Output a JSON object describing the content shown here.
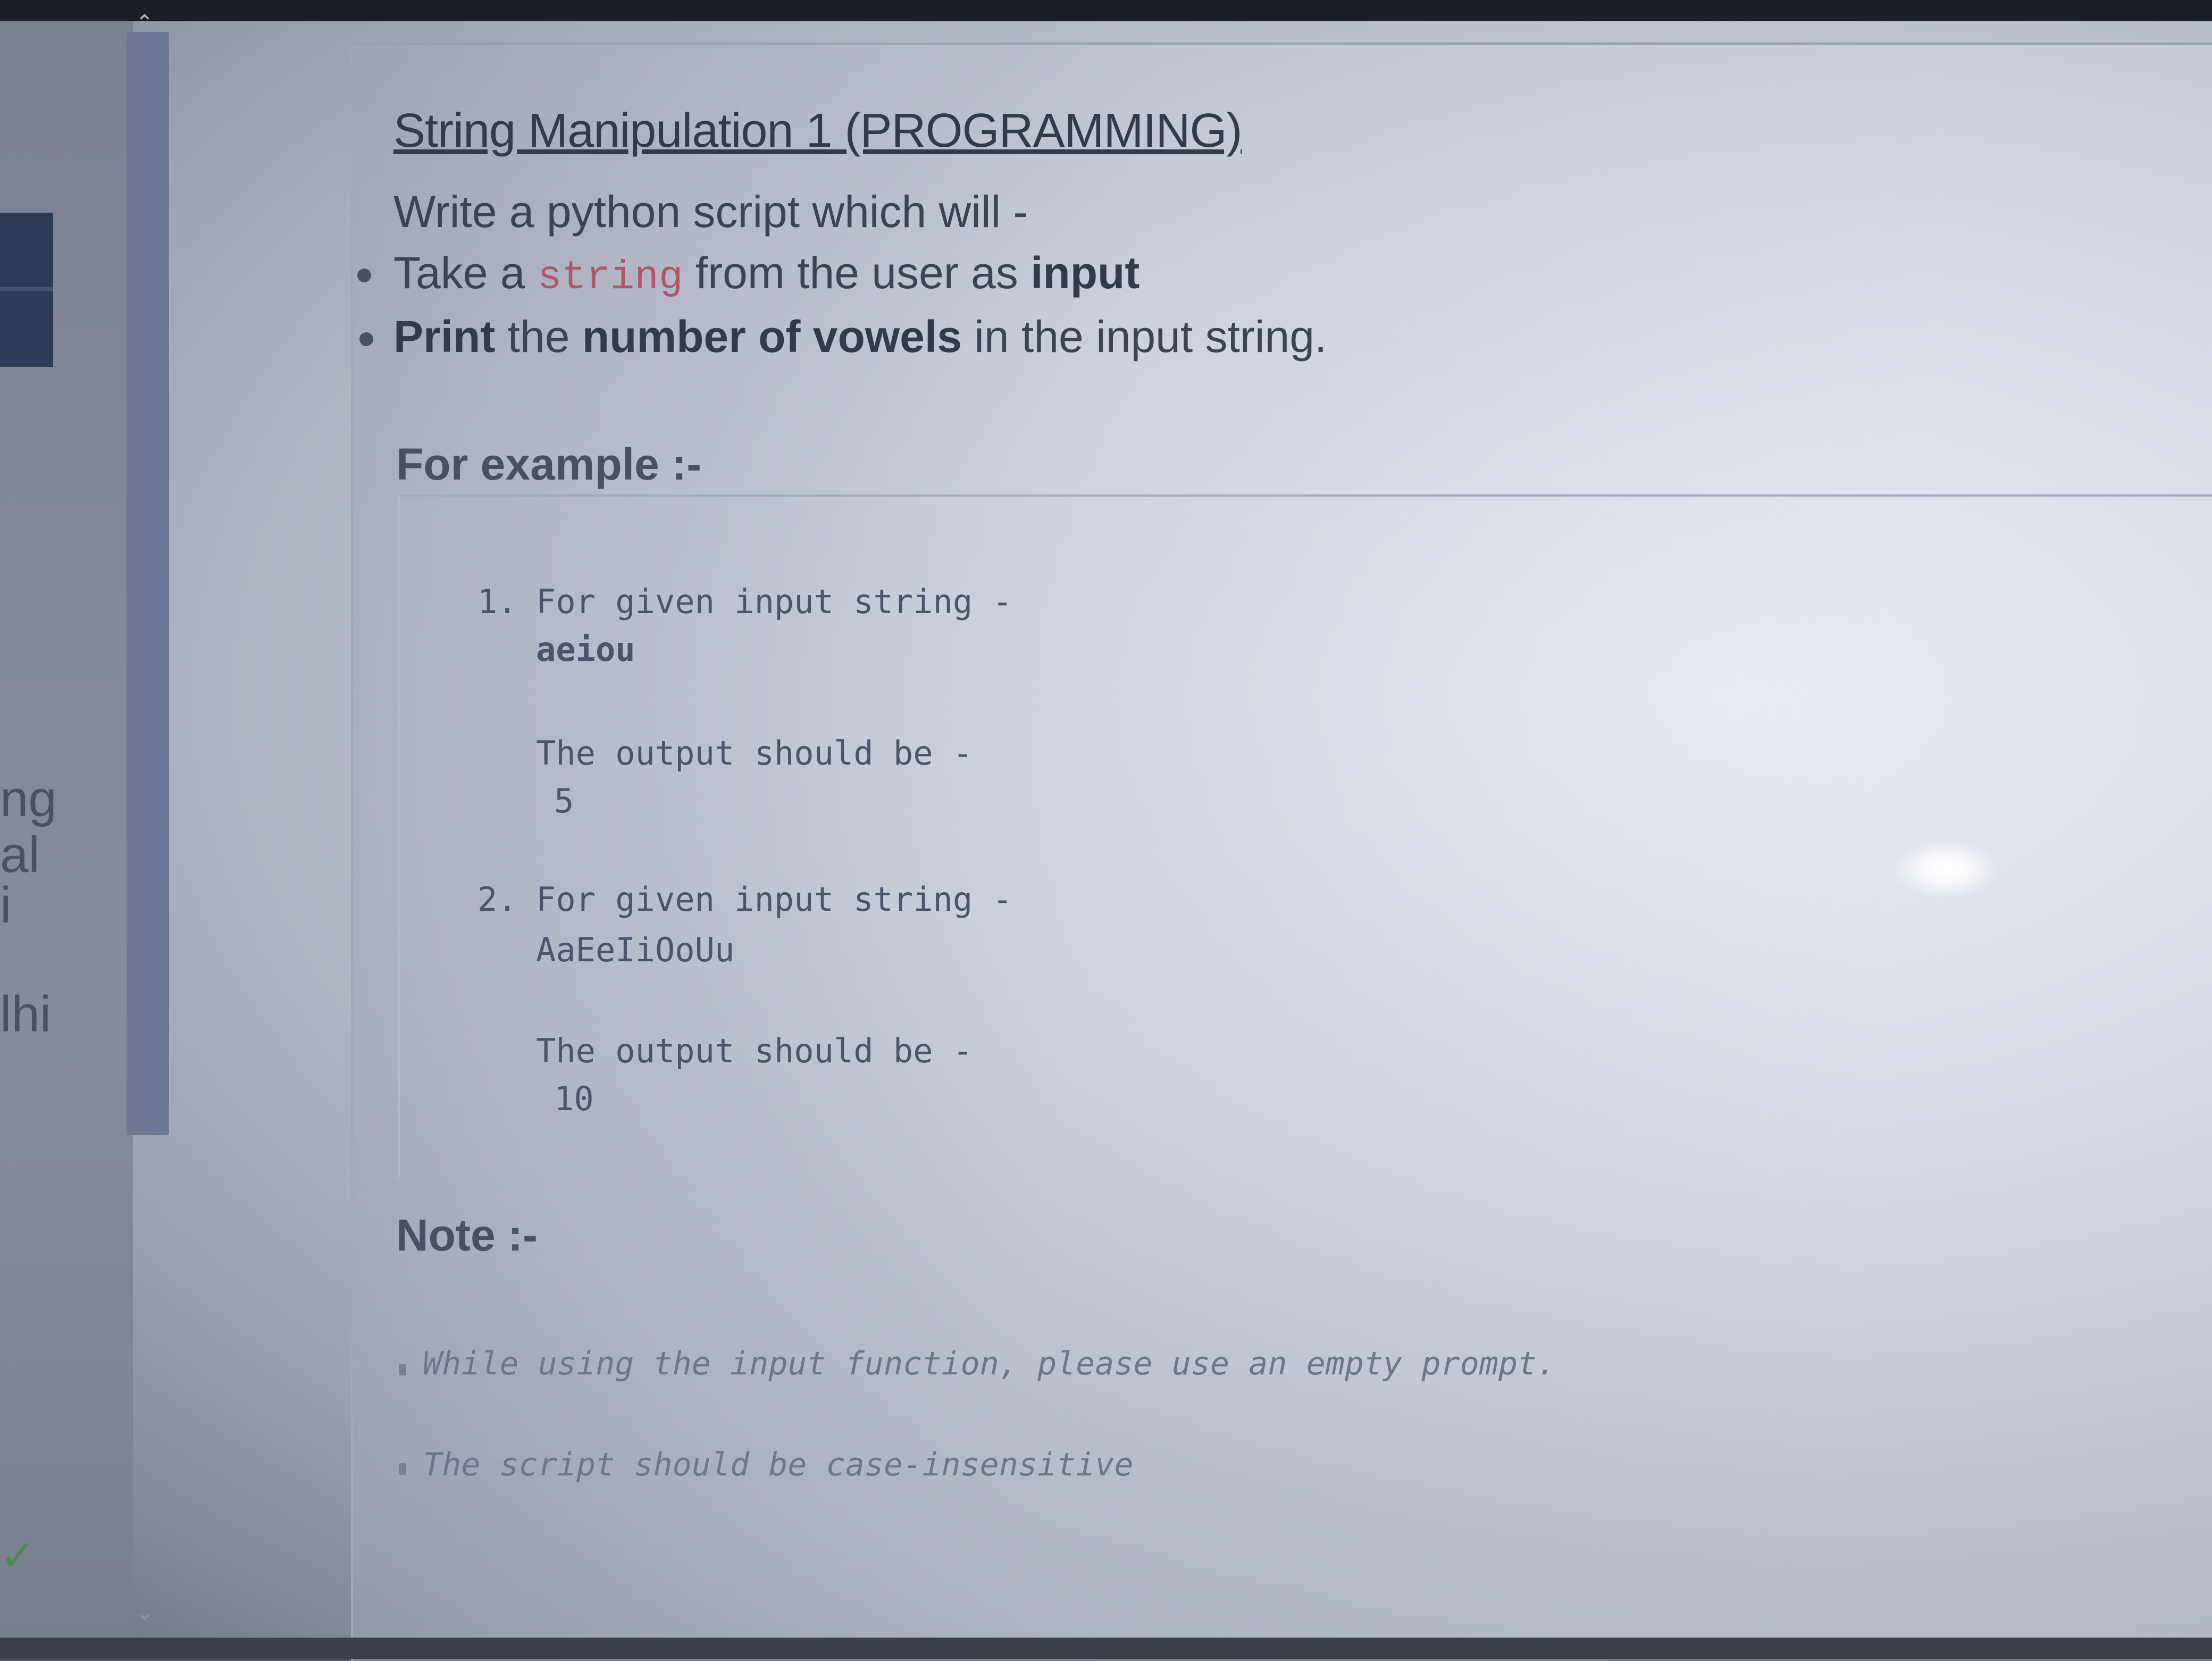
{
  "sidebar": {
    "fragments": [
      "ng",
      "al",
      "i",
      "lhi"
    ],
    "scroll_up_icon": "chevron-up-icon",
    "scroll_down_icon": "chevron-down-icon",
    "status_icon": "check-icon"
  },
  "question": {
    "title": "String Manipulation 1 (PROGRAMMING)",
    "intro": "Write a python script which will -",
    "bullets": [
      {
        "pre": "Take a ",
        "code": "string",
        "mid": " from the user as ",
        "bold": "input",
        "post": ""
      },
      {
        "bold1": "Print",
        "mid": " the ",
        "bold2": "number of vowels",
        "post": " in the input string."
      }
    ]
  },
  "examples": {
    "heading": "For example :-",
    "items": [
      {
        "number": "1.",
        "prompt": "For given input string -",
        "input": "aeiou",
        "output_label": "The output should be -",
        "output": "5"
      },
      {
        "number": "2.",
        "prompt": "For given input string -",
        "input": "AaEeIiOoUu",
        "output_label": "The output should be -",
        "output": "10"
      }
    ]
  },
  "note": {
    "heading": "Note :-",
    "items": [
      "While using the input function, please use an empty prompt.",
      "The script should be case-insensitive"
    ]
  }
}
